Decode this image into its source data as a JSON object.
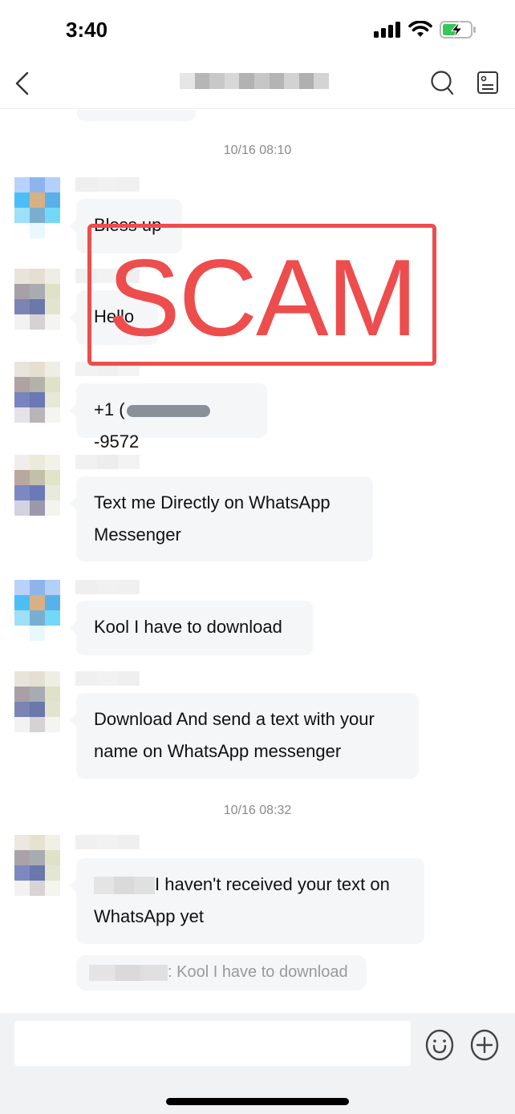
{
  "status_bar": {
    "time": "3:40",
    "icons": [
      "cellular-signal-icon",
      "wifi-icon",
      "battery-charging-icon"
    ],
    "battery_color": "#34c759"
  },
  "nav": {
    "back_icon": "chevron-left-icon",
    "title": "[redacted contact name]",
    "search_icon": "search-icon",
    "profile_icon": "contact-card-icon"
  },
  "chat": {
    "timestamps": [
      "10/16 08:10",
      "10/16 08:32"
    ],
    "messages": [
      {
        "sender": "user-a",
        "text": "Bless up"
      },
      {
        "sender": "user-b",
        "text": "Hello"
      },
      {
        "sender": "user-b",
        "text_prefix": "+1 (",
        "text_suffix": "-9572",
        "redacted": true
      },
      {
        "sender": "user-b",
        "text": "Text me Directly on WhatsApp Messenger"
      },
      {
        "sender": "user-a",
        "text": "Kool I have to download"
      },
      {
        "sender": "user-b",
        "text": "Download And send a text with your name on WhatsApp messenger"
      },
      {
        "sender": "user-b",
        "text": "I haven't received your text on WhatsApp yet",
        "mention_redacted": true
      },
      {
        "type": "quote",
        "text": ": Kool I have to download"
      }
    ]
  },
  "overlay": {
    "stamp_text": "SCAM",
    "stamp_color": "#ee4d4d"
  },
  "composer": {
    "input_value": "",
    "emoji_icon": "emoji-smile-icon",
    "plus_icon": "plus-circle-icon"
  }
}
